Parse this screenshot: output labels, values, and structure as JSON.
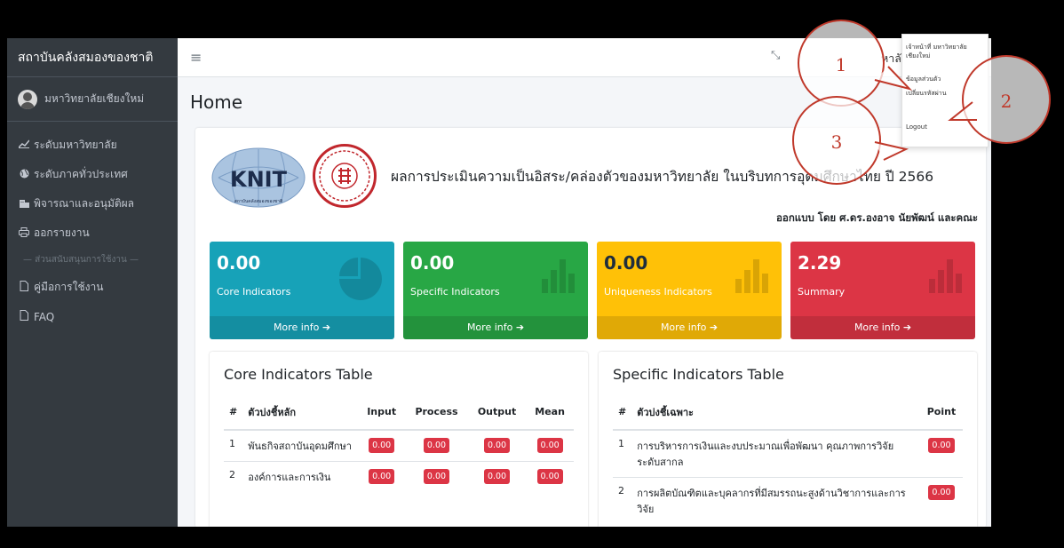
{
  "sidebar": {
    "brand": "สถาบันคลังสมองของชาติ",
    "user": "มหาวิทยาลัยเชียงใหม่",
    "items": [
      {
        "icon": "chart-line-icon",
        "label": "ระดับมหาวิทยาลัย"
      },
      {
        "icon": "globe-icon",
        "label": "ระดับภาคทั่วประเทศ"
      },
      {
        "icon": "building-check-icon",
        "label": "พิจารณาและอนุมัติผล"
      },
      {
        "icon": "printer-icon",
        "label": "ออกรายงาน"
      }
    ],
    "section_header": "— ส่วนสนับสนุนการใช้งาน —",
    "support_items": [
      {
        "icon": "file-icon",
        "label": "คู่มือการใช้งาน"
      },
      {
        "icon": "file-icon",
        "label": "FAQ"
      }
    ]
  },
  "topbar": {
    "menu_icon": "hamburger-icon",
    "expand_icon": "expand-icon",
    "user_label": "หาลัยเชียงใหม่",
    "user_icon": "user-circle-icon"
  },
  "dropdown": {
    "items": [
      "เจ้าหน้าที่ มหาวิทยาลัยเชียงใหม่",
      "ข้อมูลส่วนตัว",
      "เปลี่ยนรหัสผ่าน",
      "Logout"
    ]
  },
  "page": {
    "title": "Home",
    "headline": "ผลการประเมินความเป็นอิสระ/คล่องตัวของมหาวิทยาลัย ในบริบทการอุดมศึกษาไทย ปี 2566",
    "author": "ออกแบบ โดย ศ.ดร.องอาจ นัยพัฒน์ และคณะ",
    "logo_text": "KNIT",
    "logo_caption": "สถาบันคลังสมองของชาติ"
  },
  "stat_boxes": [
    {
      "value": "0.00",
      "label": "Core Indicators",
      "footer": "More info",
      "color": "#17a2b8",
      "icon": "pie-chart-icon"
    },
    {
      "value": "0.00",
      "label": "Specific Indicators",
      "footer": "More info",
      "color": "#28a745",
      "icon": "bar-chart-icon"
    },
    {
      "value": "0.00",
      "label": "Uniqueness Indicators",
      "footer": "More info",
      "color": "#ffc107",
      "icon": "bar-chart-icon"
    },
    {
      "value": "2.29",
      "label": "Summary",
      "footer": "More info",
      "color": "#dc3545",
      "icon": "bar-chart-icon"
    }
  ],
  "core_table": {
    "title": "Core Indicators Table",
    "headers": [
      "#",
      "ตัวบ่งชี้หลัก",
      "Input",
      "Process",
      "Output",
      "Mean"
    ],
    "rows": [
      {
        "no": "1",
        "name": "พันธกิจสถาบันอุดมศึกษา",
        "input": "0.00",
        "process": "0.00",
        "output": "0.00",
        "mean": "0.00"
      },
      {
        "no": "2",
        "name": "องค์การและการเงิน",
        "input": "0.00",
        "process": "0.00",
        "output": "0.00",
        "mean": "0.00"
      }
    ]
  },
  "specific_table": {
    "title": "Specific Indicators Table",
    "headers": [
      "#",
      "ตัวบ่งชี้เฉพาะ",
      "Point"
    ],
    "rows": [
      {
        "no": "1",
        "name": "การบริหารการเงินและงบประมาณเพื่อพัฒนา คุณภาพการวิจัยระดับสากล",
        "point": "0.00"
      },
      {
        "no": "2",
        "name": "การผลิตบัณฑิตและบุคลากรที่มีสมรรถนะสูงด้านวิชาการและการวิจัย",
        "point": "0.00"
      }
    ]
  },
  "annotations": [
    "1",
    "2",
    "3"
  ]
}
